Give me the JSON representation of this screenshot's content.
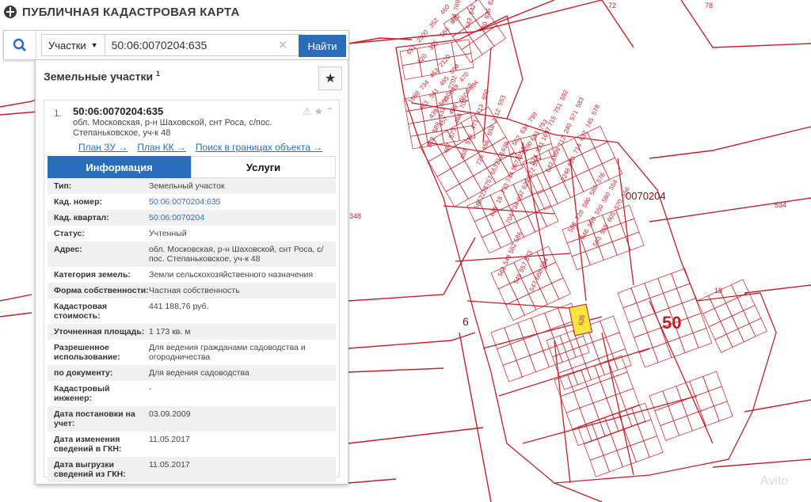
{
  "header": {
    "title": "ПУБЛИЧНАЯ КАДАСТРОВАЯ КАРТА"
  },
  "search": {
    "type_label": "Участки",
    "query": "50:06:0070204:635",
    "find_label": "Найти"
  },
  "panel": {
    "title": "Земельные участки",
    "count": "1",
    "item": {
      "number": "1.",
      "cad": "50:06:0070204:635",
      "address": "обл. Московская, р-н Шаховской, снт Роса, с/пос. Степаньковское, уч-к 48"
    },
    "links": [
      "План ЗУ →",
      "План КК →",
      "Поиск в границах объекта →"
    ],
    "tabs": [
      "Информация",
      "Услуги"
    ],
    "rows": [
      {
        "k": "Тип:",
        "v": "Земельный участок"
      },
      {
        "k": "Кад. номер:",
        "v": "50:06:0070204:635",
        "link": true
      },
      {
        "k": "Кад. квартал:",
        "v": "50:06:0070204",
        "link": true
      },
      {
        "k": "Статус:",
        "v": "Учтенный"
      },
      {
        "k": "Адрес:",
        "v": "обл. Московская, р-н Шаховской, снт Роса, с/пос. Степаньковское, уч-к 48"
      },
      {
        "k": "Категория земель:",
        "v": "Земли сельскохозяйственного назначения"
      },
      {
        "k": "Форма собственности:",
        "v": "Частная собственность"
      },
      {
        "k": "Кадастровая стоимость:",
        "v": "441 188,76 руб."
      },
      {
        "k": "Уточненная площадь:",
        "v": "1 173 кв. м"
      },
      {
        "k": "Разрешенное использование:",
        "v": "Для ведения гражданами садоводства и огородничества"
      },
      {
        "k": "по документу:",
        "v": "Для ведения садоводства"
      },
      {
        "k": "Кадастровый инженер:",
        "v": "-"
      },
      {
        "k": "Дата постановки на учет:",
        "v": "03.09.2009"
      },
      {
        "k": "Дата изменения сведений в ГКН:",
        "v": "11.05.2017"
      },
      {
        "k": "Дата выгрузки сведений из ГКН:",
        "v": "11.05.2017"
      }
    ]
  },
  "map": {
    "quarter_label": "0070204",
    "district_label": "50",
    "selected": "635",
    "edge_labels": [
      "72",
      "78",
      "534",
      "348",
      "6",
      "18"
    ],
    "parcels": [
      "651",
      "620",
      "2300",
      "355",
      "352",
      "564",
      "460",
      "722",
      "464",
      "643",
      "770",
      "769",
      "542",
      "636",
      "458",
      "825",
      "828",
      "1688",
      "463",
      "439",
      "457",
      "734",
      "541",
      "566",
      "468",
      "453",
      "465",
      "649",
      "650",
      "2120",
      "599",
      "470",
      "594",
      "812",
      "467",
      "469",
      "726",
      "589",
      "573",
      "579",
      "456",
      "432",
      "466",
      "471",
      "658",
      "730",
      "702",
      "713",
      "2112",
      "2702",
      "462",
      "650",
      "553",
      "562",
      "2290",
      "634",
      "633",
      "799",
      "793",
      "574",
      "642",
      "2246",
      "831",
      "1699",
      "830",
      "1697",
      "712",
      "714",
      "715",
      "240",
      "637",
      "751",
      "571",
      "745",
      "592",
      "583",
      "578",
      "585",
      "645",
      "704",
      "2228",
      "18",
      "734",
      "757",
      "733",
      "697",
      "653",
      "744",
      "629",
      "2101",
      "567",
      "572",
      "636",
      "2154",
      "591",
      "588",
      "646",
      "563",
      "728",
      "569",
      "555",
      "590",
      "550",
      "605",
      "586",
      "580",
      "570",
      "576",
      "554",
      "556",
      "561",
      "545",
      "547",
      "548",
      "557",
      "668",
      "562",
      "573",
      "584",
      "586"
    ],
    "parcel_color": "#c41e2a",
    "highlight_color": "#f5e642",
    "watermark": "Avito"
  }
}
